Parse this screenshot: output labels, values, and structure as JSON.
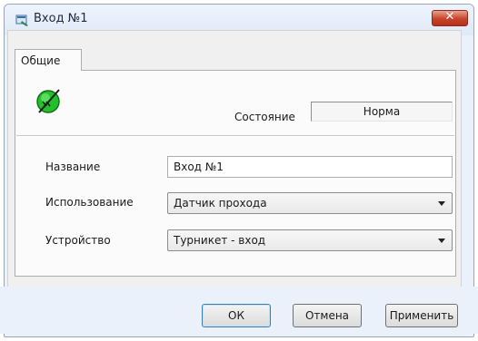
{
  "window": {
    "title": "Вход №1",
    "close_label": "✕",
    "icon": "app-icon"
  },
  "tabs": [
    {
      "label": "Общие",
      "active": true
    }
  ],
  "status": {
    "icon": "green-indicator-icon",
    "icon_color": "#22c02a",
    "label": "Состояние",
    "value": "Норма"
  },
  "fields": {
    "name": {
      "label": "Название",
      "value": "Вход №1"
    },
    "usage": {
      "label": "Использование",
      "value": "Датчик прохода"
    },
    "device": {
      "label": "Устройство",
      "value": "Турникет - вход"
    }
  },
  "buttons": {
    "ok": "ОК",
    "cancel": "Отмена",
    "apply": "Применить"
  }
}
